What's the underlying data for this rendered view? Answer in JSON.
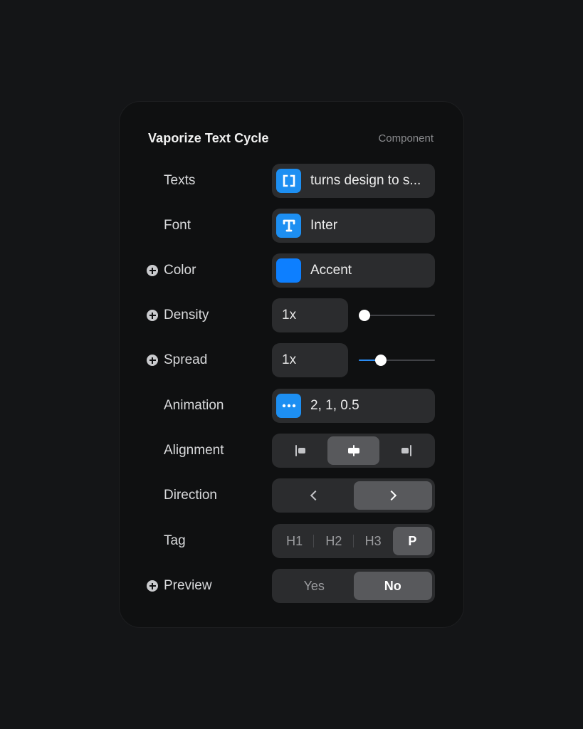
{
  "panel": {
    "title": "Vaporize Text Cycle",
    "subtitle": "Component"
  },
  "rows": {
    "texts": {
      "label": "Texts",
      "icon": "brackets-icon",
      "value": "turns design to s..."
    },
    "font": {
      "label": "Font",
      "icon": "type-icon",
      "value": "Inter"
    },
    "color": {
      "label": "Color",
      "value": "Accent",
      "swatch": "#0d7fff"
    },
    "density": {
      "label": "Density",
      "value": "1x",
      "slider_level": 0.0
    },
    "spread": {
      "label": "Spread",
      "value": "1x",
      "slider_level": 0.25
    },
    "animation": {
      "label": "Animation",
      "icon": "ellipsis-icon",
      "value": "2, 1, 0.5"
    },
    "alignment": {
      "label": "Alignment",
      "options": [
        "left",
        "center",
        "right"
      ],
      "selected": "center"
    },
    "direction": {
      "label": "Direction",
      "options": [
        "left",
        "right"
      ],
      "selected": "right"
    },
    "tag": {
      "label": "Tag",
      "options": [
        "H1",
        "H2",
        "H3",
        "P"
      ],
      "selected": "P"
    },
    "preview": {
      "label": "Preview",
      "options": [
        "Yes",
        "No"
      ],
      "selected": "No"
    }
  },
  "colors": {
    "accent": "#1d8ff2",
    "panel_bg": "#0f1011",
    "control_bg": "#2b2c2e",
    "active_segment": "#58595c"
  }
}
